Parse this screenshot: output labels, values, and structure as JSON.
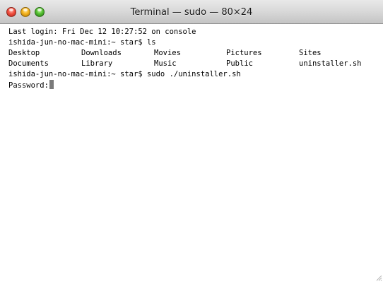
{
  "window": {
    "title": "Terminal — sudo — 80×24"
  },
  "terminal": {
    "last_login": "Last login: Fri Dec 12 10:27:52 on console",
    "prompt_ls": "ishida-jun-no-mac-mini:~ star$ ls",
    "ls_row1": [
      "Desktop",
      "Downloads",
      "Movies",
      "Pictures",
      "Sites"
    ],
    "ls_row2": [
      "Documents",
      "Library",
      "Music",
      "Public",
      "uninstaller.sh"
    ],
    "prompt_sudo": "ishida-jun-no-mac-mini:~ star$ sudo ./uninstaller.sh",
    "password_prompt": "Password:"
  },
  "icons": [
    "close-icon",
    "minimize-icon",
    "zoom-icon",
    "resize-grip-icon"
  ],
  "colors": {
    "close": "#f14f3f",
    "minimize": "#f4b31c",
    "zoom": "#54c032",
    "cursor": "#7a7a7a"
  }
}
